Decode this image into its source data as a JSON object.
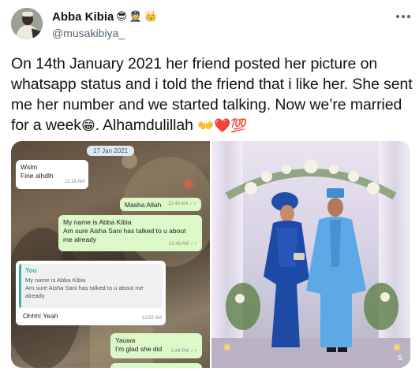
{
  "author": {
    "display_name": "Abba Kibia",
    "name_emojis": [
      "😎",
      "👮",
      "👑"
    ],
    "handle": "@musakibiya_"
  },
  "tweet": {
    "text_main": "On 14th January 2021 her friend posted her picture on whatsapp status and i told the friend that i like her. She sent me her number and we started talking. Now we’re married for a week",
    "emoji_grin": "😁",
    "text_tail": ". Alhamdulillah",
    "tail_emojis": "👐❤️💯"
  },
  "chat_screenshot": {
    "date": "17 Jan 2021",
    "messages": [
      {
        "type": "in",
        "lines": [
          "Wslm",
          "Fine alhdlh"
        ],
        "time": "12:18 AM"
      },
      {
        "type": "out",
        "lines": [
          "Masha Allah"
        ],
        "time": "12:43 AM"
      },
      {
        "type": "out",
        "lines": [
          "My name is Abba Kibia",
          "Am sure Aisha Sani has talked to u about",
          "me already"
        ],
        "time": "12:43 AM"
      },
      {
        "type": "in-reply",
        "quote_author": "You",
        "quote_lines": [
          "My name is Abba Kibia",
          "Am sure Aisha Sani has talked to u about me",
          "already"
        ],
        "lines": [
          "Ohhh! Yeah"
        ],
        "time": "12:52 AM"
      },
      {
        "type": "out",
        "lines": [
          "Yauwa",
          "I'm glad she did"
        ],
        "time": "2:44 PM"
      }
    ]
  },
  "wedding_photo": {
    "watermark": "S"
  },
  "colors": {
    "accent": "#1d9bf0",
    "text": "#0f1419",
    "muted": "#536471",
    "wa_out": "#dcf8c6",
    "wa_in": "#ffffff"
  },
  "icons": {
    "more": "more-horizontal-icon",
    "tick": "double-check-icon"
  }
}
